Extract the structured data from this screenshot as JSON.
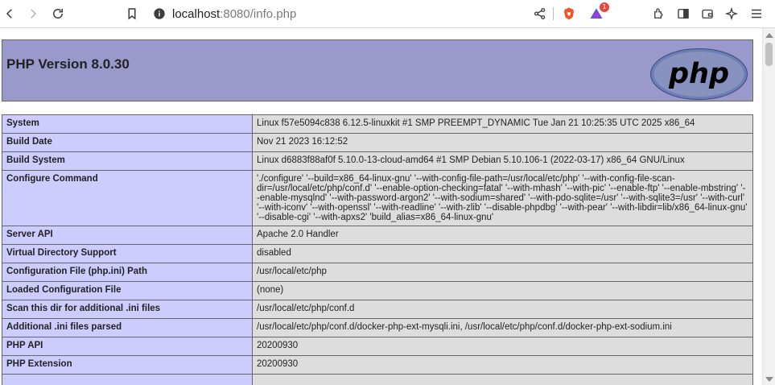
{
  "browser": {
    "url_host": "localhost",
    "url_rest": ":8080/info.php",
    "notification_count": "1"
  },
  "header": {
    "title": "PHP Version 8.0.30",
    "logo_text": "php"
  },
  "rows": [
    {
      "label": "System",
      "value": "Linux f57e5094c838 6.12.5-linuxkit #1 SMP PREEMPT_DYNAMIC Tue Jan 21 10:25:35 UTC 2025 x86_64"
    },
    {
      "label": "Build Date",
      "value": "Nov 21 2023 16:12:52"
    },
    {
      "label": "Build System",
      "value": "Linux d6883f88af0f 5.10.0-13-cloud-amd64 #1 SMP Debian 5.10.106-1 (2022-03-17) x86_64 GNU/Linux"
    },
    {
      "label": "Configure Command",
      "value": "'./configure' '--build=x86_64-linux-gnu' '--with-config-file-path=/usr/local/etc/php' '--with-config-file-scan-dir=/usr/local/etc/php/conf.d' '--enable-option-checking=fatal' '--with-mhash' '--with-pic' '--enable-ftp' '--enable-mbstring' '--enable-mysqlnd' '--with-password-argon2' '--with-sodium=shared' '--with-pdo-sqlite=/usr' '--with-sqlite3=/usr' '--with-curl' '--with-iconv' '--with-openssl' '--with-readline' '--with-zlib' '--disable-phpdbg' '--with-pear' '--with-libdir=lib/x86_64-linux-gnu' '--disable-cgi' '--with-apxs2' 'build_alias=x86_64-linux-gnu'"
    },
    {
      "label": "Server API",
      "value": "Apache 2.0 Handler"
    },
    {
      "label": "Virtual Directory Support",
      "value": "disabled"
    },
    {
      "label": "Configuration File (php.ini) Path",
      "value": "/usr/local/etc/php"
    },
    {
      "label": "Loaded Configuration File",
      "value": "(none)"
    },
    {
      "label": "Scan this dir for additional .ini files",
      "value": "/usr/local/etc/php/conf.d"
    },
    {
      "label": "Additional .ini files parsed",
      "value": "/usr/local/etc/php/conf.d/docker-php-ext-mysqli.ini, /usr/local/etc/php/conf.d/docker-php-ext-sodium.ini"
    },
    {
      "label": "PHP API",
      "value": "20200930"
    },
    {
      "label": "PHP Extension",
      "value": "20200930"
    },
    {
      "label": "",
      "value": ""
    }
  ],
  "colors": {
    "header_bg": "#9999cc",
    "label_bg": "#ccccff",
    "value_bg": "#dddddd"
  }
}
